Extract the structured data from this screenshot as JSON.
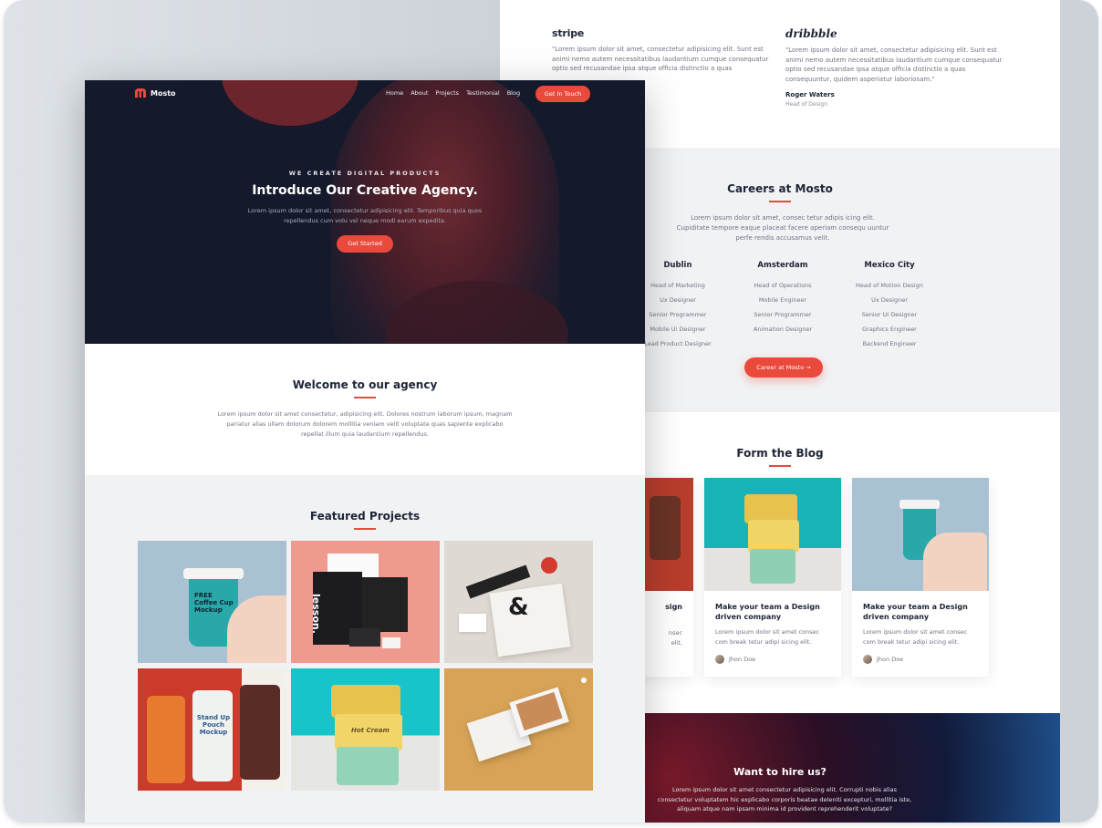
{
  "testimonials": [
    {
      "brand": "stripe",
      "quote": "\"Lorem ipsum dolor sit amet, consectetur adipisicing elit. Sunt est animi nemo autem necessitatibus laudantium cumque consequatur optio sed recusandae ipsa atque officia distinctio a quas consequuntur, quidem asperiatur laboriosam.\""
    },
    {
      "brand": "dribbble",
      "quote": "\"Lorem ipsum dolor sit amet, consectetur adipisicing elit. Sunt est animi nemo autem necessitatibus laudantium cumque consequatur optio sed recusandae ipsa atque officia distinctio a quas consequuntur, quidem asperiatur laboriosam.\"",
      "name": "Roger Waters",
      "role": "Head of Design"
    }
  ],
  "careers": {
    "title": "Careers at Mosto",
    "intro": "Lorem ipsum dolor sit amet, consec tetur adipis icing elit. Cupiditate tempore eaque placeat facere aperiam consequ uuntur perfe rendis accusamus velit.",
    "cities": [
      {
        "name": "Dublin",
        "jobs": [
          "Head of Marketing",
          "Ux Designer",
          "Senior Programmer",
          "Mobile Ui Designer",
          "Lead Product Designer"
        ]
      },
      {
        "name": "Amsterdam",
        "jobs": [
          "Head of Operations",
          "Mobile Engineer",
          "Senior Programmer",
          "Animation Designer"
        ]
      },
      {
        "name": "Mexico City",
        "jobs": [
          "Head of Motion Design",
          "Ux Designer",
          "Senior UI Designer",
          "Graphics Engineer",
          "Backend Engineer"
        ]
      }
    ],
    "button_label": "Career at Mosto →"
  },
  "blog": {
    "title": "Form the Blog",
    "partial_card": {
      "title_tail": "sign",
      "text_tail": [
        "nsec",
        "elit."
      ]
    },
    "cards": [
      {
        "title": "Make your team a Design driven company",
        "text": "Lorem ipsum dolor sit amet consec com break tetur adipi sicing elit.",
        "author": "Jhon Doe"
      },
      {
        "title": "Make your team a Design driven company",
        "text": "Lorem ipsum dolor sit amet consec com break tetur adipi sicing elit.",
        "author": "Jhon Doe"
      }
    ]
  },
  "hire": {
    "title": "Want to hire us?",
    "text": "Lorem ipsum dolor sit amet consectetur adipisicing elit. Corrupti nobis alias consectetur voluptatem hic explicabo corporis beatae deleniti excepturi, mollitia iste, aliquam atque nam ipsam minima id provident reprehenderit voluptate?"
  },
  "front": {
    "logo_text": "Mosto",
    "nav": [
      "Home",
      "About",
      "Projects",
      "Testimonial",
      "Blog"
    ],
    "nav_button": "Get In Touch",
    "hero": {
      "eyebrow": "WE CREATE DIGITAL PRODUCTS",
      "title": "Introduce Our Creative Agency.",
      "text": "Lorem ipsum dolor sit amet, consectetur adipisicing elit. Temporibus quia quos repellendus cum volu vel neque modi earum expedita.",
      "button": "Get Started"
    },
    "welcome": {
      "title": "Welcome to our agency",
      "text": "Lorem ipsum dolor sit amet consectetur, adipisicing elit. Dolores nostrum laborum ipsum, magnam pariatur alias ullam dolorum dolorem mollitia veniam velit voluptate quas sapiente explicabo repellat illum quia laudantium repellendus."
    },
    "projects": {
      "title": "Featured Projects",
      "tiles": [
        {
          "name": "coffee-cup-mockup",
          "cup_text": "FREE Coffee Cup Mockup"
        },
        {
          "name": "stationery-mockup",
          "brand_text": "lesson."
        },
        {
          "name": "branding-mockup"
        },
        {
          "name": "pouch-mockup",
          "pouch_text": "Stand Up Pouch Mockup"
        },
        {
          "name": "paper-cups-mockup",
          "cup_brand": "Hot Cream"
        },
        {
          "name": "postcard-mockup"
        }
      ]
    }
  },
  "colors": {
    "accent": "#e94a3c",
    "dark": "#141a2b",
    "heading": "#1e2436",
    "muted": "#6f7482",
    "section_bg": "#f1f2f4"
  }
}
